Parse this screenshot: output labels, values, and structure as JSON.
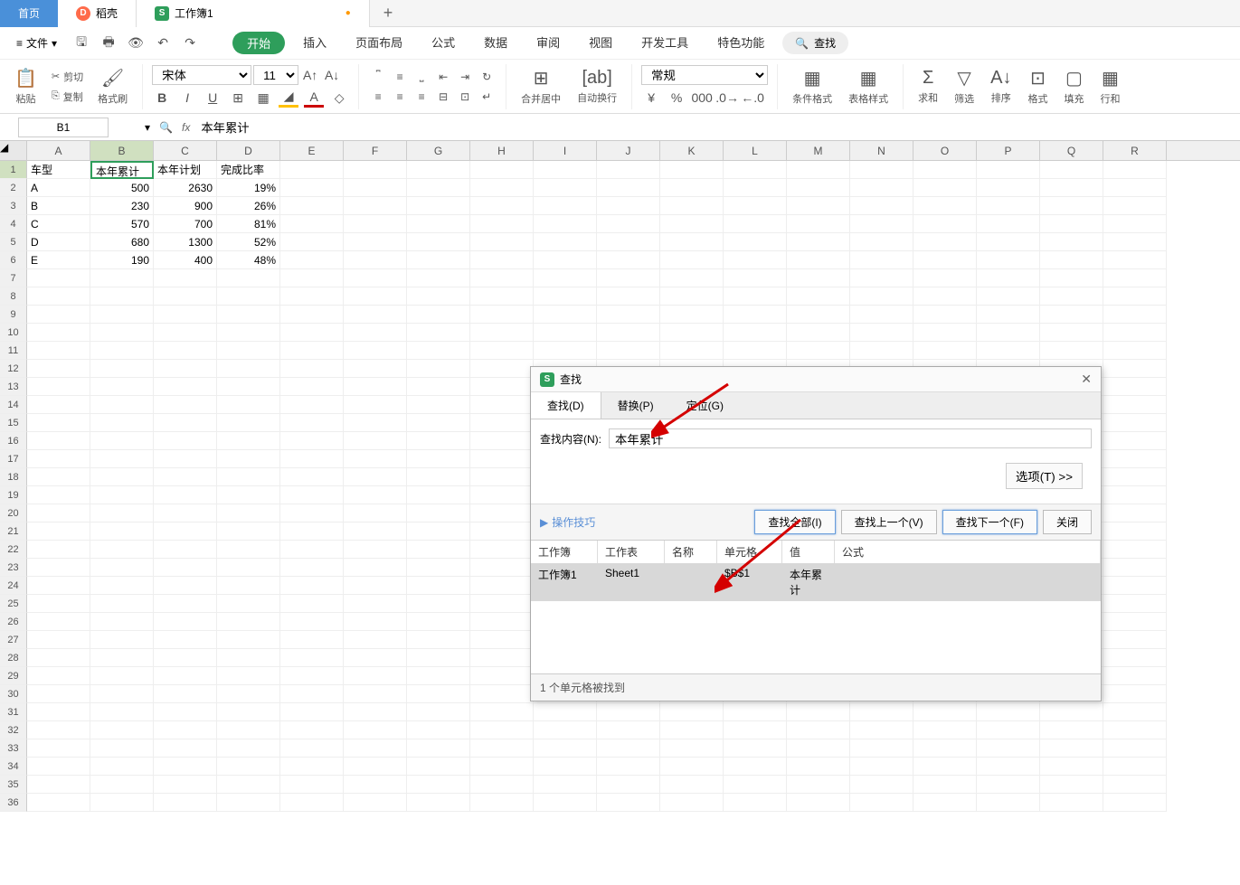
{
  "tabs": {
    "home": "首页",
    "docer": "稻壳",
    "workbook": "工作簿1"
  },
  "file_menu": "文件",
  "menu": {
    "start": "开始",
    "insert": "插入",
    "layout": "页面布局",
    "formula": "公式",
    "data": "数据",
    "review": "审阅",
    "view": "视图",
    "dev": "开发工具",
    "special": "特色功能",
    "search": "查找"
  },
  "ribbon": {
    "paste": "粘贴",
    "cut": "剪切",
    "copy": "复制",
    "format_painter": "格式刷",
    "font_name": "宋体",
    "font_size": "11",
    "merge_center": "合并居中",
    "wrap_text": "自动换行",
    "number_fmt": "常规",
    "cond_fmt": "条件格式",
    "table_style": "表格样式",
    "sum": "求和",
    "filter": "筛选",
    "sort": "排序",
    "format": "格式",
    "fill": "填充",
    "rowcol": "行和"
  },
  "cell_ref": "B1",
  "formula_value": "本年累计",
  "columns": [
    "A",
    "B",
    "C",
    "D",
    "E",
    "F",
    "G",
    "H",
    "I",
    "J",
    "K",
    "L",
    "M",
    "N",
    "O",
    "P",
    "Q",
    "R"
  ],
  "data_rows": [
    {
      "r": 1,
      "A": "车型",
      "B": "本年累计",
      "C": "本年计划",
      "D": "完成比率"
    },
    {
      "r": 2,
      "A": "A",
      "B": "500",
      "C": "2630",
      "D": "19%"
    },
    {
      "r": 3,
      "A": "B",
      "B": "230",
      "C": "900",
      "D": "26%"
    },
    {
      "r": 4,
      "A": "C",
      "B": "570",
      "C": "700",
      "D": "81%"
    },
    {
      "r": 5,
      "A": "D",
      "B": "680",
      "C": "1300",
      "D": "52%"
    },
    {
      "r": 6,
      "A": "E",
      "B": "190",
      "C": "400",
      "D": "48%"
    }
  ],
  "dialog": {
    "title": "查找",
    "tab_find": "查找(D)",
    "tab_replace": "替换(P)",
    "tab_goto": "定位(G)",
    "label_content": "查找内容(N):",
    "input_value": "本年累计",
    "options": "选项(T) >>",
    "tips": "操作技巧",
    "find_all": "查找全部(I)",
    "find_prev": "查找上一个(V)",
    "find_next": "查找下一个(F)",
    "close": "关闭",
    "col_workbook": "工作簿",
    "col_sheet": "工作表",
    "col_name": "名称",
    "col_cell": "单元格",
    "col_value": "值",
    "col_formula": "公式",
    "res_workbook": "工作簿1",
    "res_sheet": "Sheet1",
    "res_cell": "$B$1",
    "res_value": "本年累计",
    "status": "1 个单元格被找到"
  }
}
